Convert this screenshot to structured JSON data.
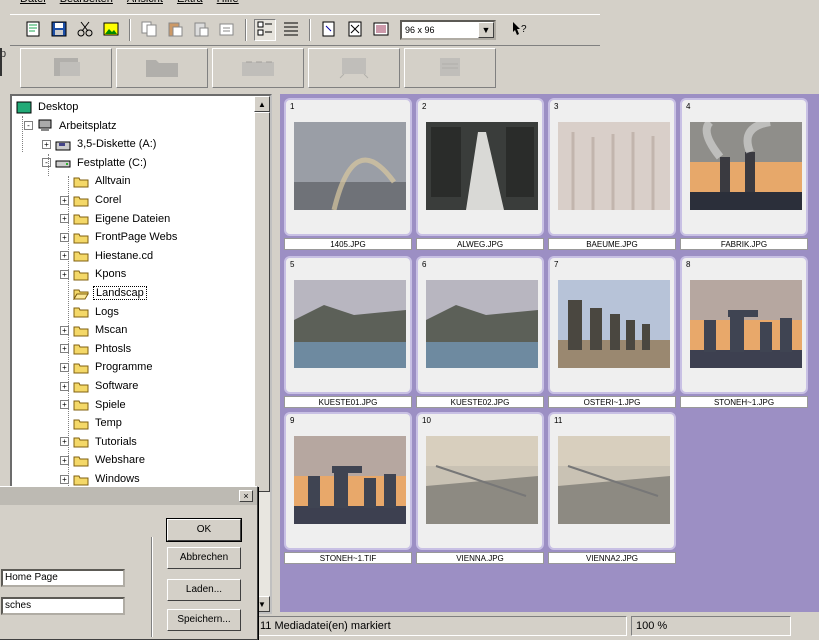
{
  "menu": [
    "Datei",
    "Bearbeiten",
    "Ansicht",
    "Extra",
    "Hilfe"
  ],
  "toolbar": {
    "buttons": [
      "new-icon",
      "save-icon",
      "cut-icon",
      "image-icon",
      "copy-icon",
      "paste-icon",
      "paste-special-icon",
      "properties-icon",
      "thumbnails-view-icon",
      "details-view-icon",
      "filter-icon",
      "delete-icon",
      "slideshow-icon"
    ],
    "size_value": "96 x 96",
    "help_icon": "context-help-icon"
  },
  "bigbar": [
    "import-icon",
    "folder-icon",
    "camera-icon",
    "print-icon",
    "scanner-icon"
  ],
  "left_edge_text": "p",
  "tree": [
    {
      "label": "Desktop",
      "level": 0,
      "icon": "desktop-icon",
      "expander": ""
    },
    {
      "label": "Arbeitsplatz",
      "level": 1,
      "icon": "computer-icon",
      "expander": "-"
    },
    {
      "label": "3,5-Diskette (A:)",
      "level": 2,
      "icon": "floppy-icon",
      "expander": "+"
    },
    {
      "label": "Festplatte (C:)",
      "level": 2,
      "icon": "drive-icon",
      "expander": "-"
    },
    {
      "label": "Alltvain",
      "level": 3,
      "icon": "folder-icon",
      "expander": ""
    },
    {
      "label": "Corel",
      "level": 3,
      "icon": "folder-icon",
      "expander": "+"
    },
    {
      "label": "Eigene Dateien",
      "level": 3,
      "icon": "folder-icon",
      "expander": "+"
    },
    {
      "label": "FrontPage Webs",
      "level": 3,
      "icon": "folder-icon",
      "expander": "+"
    },
    {
      "label": "Hiestane.cd",
      "level": 3,
      "icon": "folder-icon",
      "expander": "+"
    },
    {
      "label": "Kpons",
      "level": 3,
      "icon": "folder-icon",
      "expander": "+"
    },
    {
      "label": "Landscap",
      "level": 3,
      "icon": "open-folder-icon",
      "expander": "",
      "selected": true
    },
    {
      "label": "Logs",
      "level": 3,
      "icon": "folder-icon",
      "expander": ""
    },
    {
      "label": "Mscan",
      "level": 3,
      "icon": "folder-icon",
      "expander": "+"
    },
    {
      "label": "Phtosls",
      "level": 3,
      "icon": "folder-icon",
      "expander": "+"
    },
    {
      "label": "Programme",
      "level": 3,
      "icon": "folder-icon",
      "expander": "+"
    },
    {
      "label": "Software",
      "level": 3,
      "icon": "folder-icon",
      "expander": "+"
    },
    {
      "label": "Spiele",
      "level": 3,
      "icon": "folder-icon",
      "expander": "+"
    },
    {
      "label": "Temp",
      "level": 3,
      "icon": "folder-icon",
      "expander": ""
    },
    {
      "label": "Tutorials",
      "level": 3,
      "icon": "folder-icon",
      "expander": "+"
    },
    {
      "label": "Webshare",
      "level": 3,
      "icon": "folder-icon",
      "expander": "+"
    },
    {
      "label": "Windows",
      "level": 3,
      "icon": "folder-icon",
      "expander": "+"
    }
  ],
  "thumbnails": [
    {
      "num": "1",
      "file": "1405.JPG",
      "img": "rainbow-photo-icon"
    },
    {
      "num": "2",
      "file": "ALWEG.JPG",
      "img": "alley-photo-icon"
    },
    {
      "num": "3",
      "file": "BAEUME.JPG",
      "img": "trees-photo-icon"
    },
    {
      "num": "4",
      "file": "FABRIK.JPG",
      "img": "factory-photo-icon"
    },
    {
      "num": "5",
      "file": "KUESTE01.JPG",
      "img": "coast-photo-icon"
    },
    {
      "num": "6",
      "file": "KUESTE02.JPG",
      "img": "coast-photo-icon"
    },
    {
      "num": "7",
      "file": "OSTERI~1.JPG",
      "img": "moai-photo-icon"
    },
    {
      "num": "8",
      "file": "STONEH~1.JPG",
      "img": "stonehenge-photo-icon"
    },
    {
      "num": "9",
      "file": "STONEH~1.TIF",
      "img": "stonehenge-photo-icon"
    },
    {
      "num": "10",
      "file": "VIENNA.JPG",
      "img": "city-photo-icon"
    },
    {
      "num": "11",
      "file": "VIENNA2.JPG",
      "img": "city-photo-icon"
    }
  ],
  "status": {
    "left": "",
    "marked": "11 Mediadatei(en) markiert",
    "zoom": "100 %"
  },
  "dialog": {
    "ok": "OK",
    "cancel": "Abbrechen",
    "load": "Laden...",
    "save": "Speichern...",
    "field1": "Home Page",
    "field2": "sches"
  },
  "colors": {
    "panel_bg": "#9c8fc4",
    "card_border": "#c8c0e4",
    "chrome": "#d4d0c8"
  }
}
